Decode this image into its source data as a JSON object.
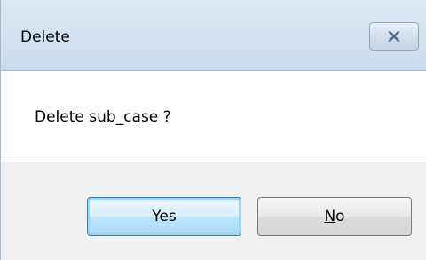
{
  "window": {
    "title": "Delete",
    "close_icon": "close-icon"
  },
  "dialog": {
    "message": "Delete sub_case ?"
  },
  "buttons": {
    "yes_label": "Yes",
    "no_label_mnemonic": "N",
    "no_label_rest": "o"
  },
  "colors": {
    "titlebar": "#c9dcef",
    "footer": "#f0f0f0",
    "default_button_border": "#3c7fb1"
  }
}
